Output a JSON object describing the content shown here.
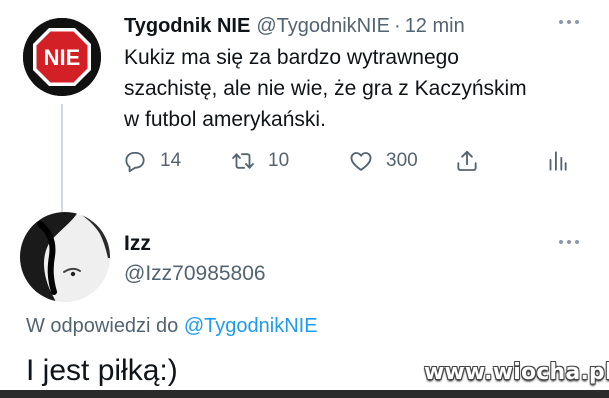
{
  "tweet": {
    "author_name": "Tygodnik NIE",
    "author_handle": "@TygodnikNIE",
    "dot": "·",
    "time": "12 min",
    "avatar_text": "NIE",
    "text": "Kukiz ma się za bardzo wytrawnego\nszachistę, ale nie wie, że gra z Kaczyńskim\nw futbol amerykański.",
    "actions": {
      "reply_count": "14",
      "retweet_count": "10",
      "like_count": "300"
    },
    "colors": {
      "stop_sign": "#d32027",
      "muted": "#536471"
    }
  },
  "reply": {
    "author_name": "Izz",
    "author_handle": "@Izz70985806",
    "replying_prefix": "W odpowiedzi do ",
    "replying_mention": "@TygodnikNIE",
    "text": "I jest piłką:)",
    "colors": {
      "mention": "#1d9bf0"
    }
  },
  "watermark": "www.wiocha.pl",
  "icons": [
    "more-icon",
    "reply-icon",
    "retweet-icon",
    "like-icon",
    "share-icon",
    "analytics-icon"
  ]
}
